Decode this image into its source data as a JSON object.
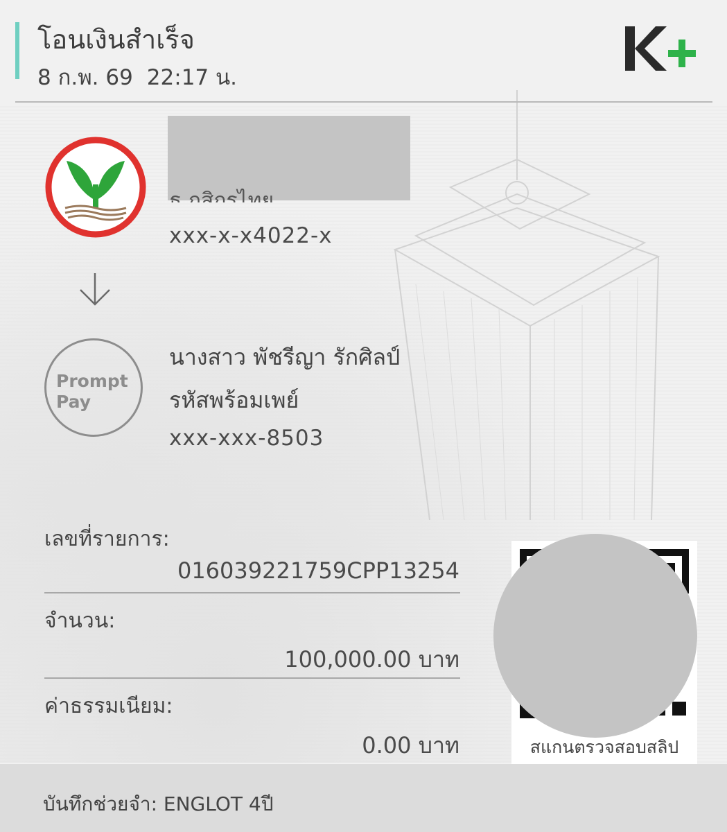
{
  "header": {
    "title": "โอนเงินสำเร็จ",
    "date": "8 ก.พ. 69",
    "time": "22:17 น.",
    "brand": "K+",
    "accent_color": "#6fcfc1",
    "brand_green": "#2eb24a"
  },
  "sender": {
    "bank_logo_icon": "kasikornbank-logo-icon",
    "bank_name_partial": "ธ.กสิกรไทย",
    "account": "xxx-x-x4022-x"
  },
  "receiver": {
    "logo_line1": "Prompt",
    "logo_line2": "Pay",
    "name": "นางสาว พัชรีญา รักศิลป์",
    "type": "รหัสพร้อมเพย์",
    "account": "xxx-xxx-8503"
  },
  "transaction": {
    "ref_label": "เลขที่รายการ:",
    "ref_value": "016039221759CPP13254",
    "amount_label": "จำนวน:",
    "amount_value": "100,000.00 บาท",
    "fee_label": "ค่าธรรมเนียม:",
    "fee_value": "0.00 บาท"
  },
  "qr": {
    "caption": "สแกนตรวจสอบสลิป"
  },
  "memo": {
    "text": "บันทึกช่วยจำ: ENGLOT 4ปี"
  }
}
